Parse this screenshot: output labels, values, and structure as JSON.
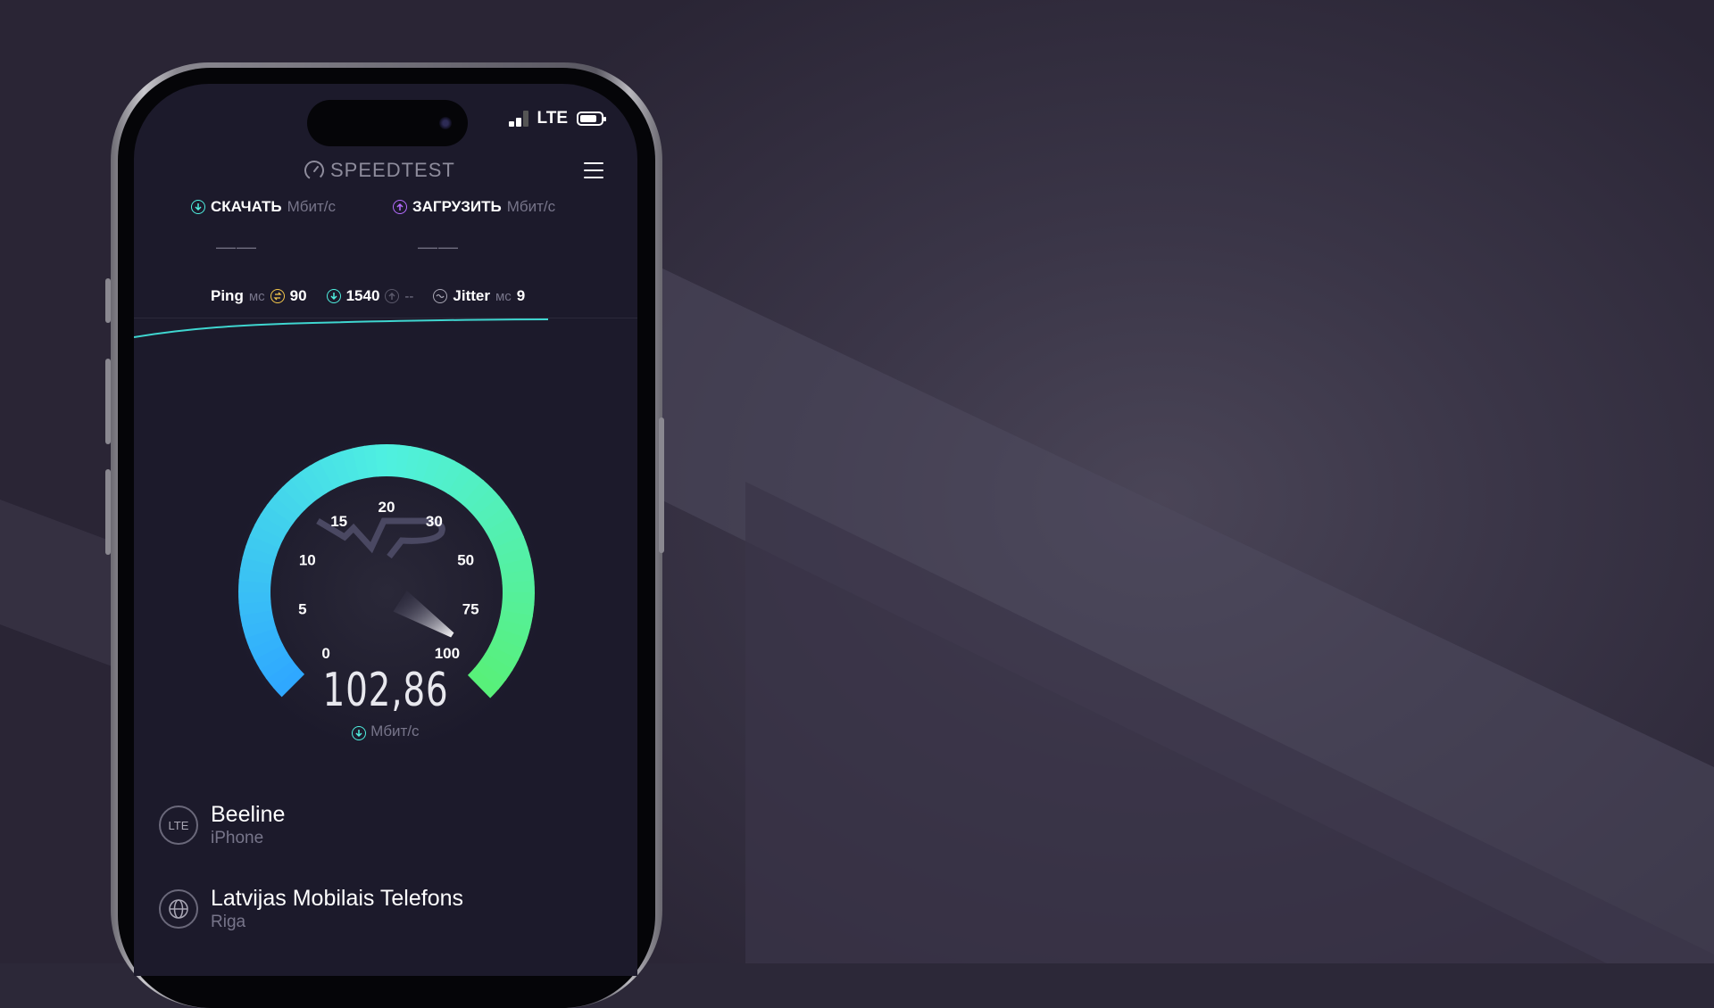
{
  "app": {
    "name": "SPEEDTEST"
  },
  "status_bar": {
    "network": "LTE"
  },
  "header": {
    "download_label": "СКАЧАТЬ",
    "download_unit": "Мбит/с",
    "upload_label": "ЗАГРУЗИТЬ",
    "upload_unit": "Мбит/с",
    "download_value": "——",
    "upload_value": "——"
  },
  "metrics": {
    "ping_label": "Ping",
    "ping_unit": "мс",
    "ping_value": "90",
    "ping_down": "1540",
    "ping_up": "--",
    "jitter_label": "Jitter",
    "jitter_unit": "мс",
    "jitter_value": "9"
  },
  "gauge": {
    "ticks": [
      "0",
      "5",
      "10",
      "15",
      "20",
      "30",
      "50",
      "75",
      "100"
    ],
    "needle_value": "100",
    "reading": "102,86",
    "unit": "Мбит/с",
    "colors": {
      "start": "#2fa8ff",
      "mid": "#4ff0e0",
      "end": "#58f07a"
    }
  },
  "connections": [
    {
      "badge": "LTE",
      "title": "Beeline",
      "subtitle": "iPhone"
    },
    {
      "badge": "globe-icon",
      "title": "Latvijas Mobilais Telefons",
      "subtitle": "Riga"
    }
  ]
}
